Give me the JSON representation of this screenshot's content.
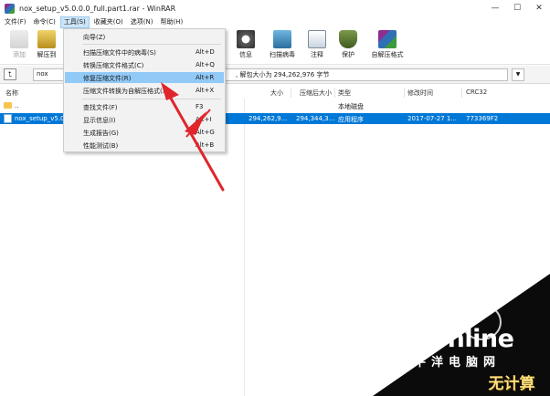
{
  "window": {
    "title": "nox_setup_v5.0.0.0_full.part1.rar - WinRAR",
    "controls": [
      "—",
      "☐",
      "✕"
    ]
  },
  "menubar": {
    "items": [
      "文件(F)",
      "命令(C)",
      "工具(S)",
      "收藏夹(O)",
      "选项(N)",
      "帮助(H)"
    ]
  },
  "toolbar": {
    "items": [
      {
        "label": "添加",
        "icon": "add-archive-icon",
        "disabled": true
      },
      {
        "label": "解压到",
        "icon": "extract-to-icon",
        "disabled": false
      },
      {
        "label": "信息",
        "icon": "info-icon",
        "disabled": false
      },
      {
        "label": "扫描病毒",
        "icon": "virus-scan-icon",
        "disabled": false
      },
      {
        "label": "注释",
        "icon": "comment-icon",
        "disabled": false
      },
      {
        "label": "保护",
        "icon": "protect-icon",
        "disabled": false
      },
      {
        "label": "自解压格式",
        "icon": "sfx-icon",
        "disabled": false
      }
    ]
  },
  "addressbar": {
    "up_glyph": "⮤",
    "path_prefix": "nox",
    "path_text": ", 解包大小为 294,262,976 字节"
  },
  "list": {
    "columns": [
      "名称",
      "大小",
      "压缩后大小",
      "类型",
      "修改时间",
      "CRC32"
    ],
    "rows": [
      {
        "name": "..",
        "size": "",
        "packed": "",
        "type": "本地磁盘",
        "modified": "",
        "crc": "",
        "selected": false
      },
      {
        "name": "nox_setup_v5.0",
        "size": "294,262,9...",
        "packed": "294,344,3...",
        "type": "应用程序",
        "modified": "2017-07-27 1...",
        "crc": "773369F2",
        "selected": true
      }
    ]
  },
  "tools_menu": {
    "items": [
      {
        "label": "向导(Z)",
        "shortcut": "",
        "highlighted": false
      },
      {
        "label": "扫描压缩文件中的病毒(S)",
        "shortcut": "Alt+D",
        "highlighted": false
      },
      {
        "label": "转换压缩文件格式(C)",
        "shortcut": "Alt+Q",
        "highlighted": false
      },
      {
        "label": "修复压缩文件(R)",
        "shortcut": "Alt+R",
        "highlighted": true
      },
      {
        "label": "压缩文件转换为自解压格式(X)",
        "shortcut": "Alt+X",
        "highlighted": false
      },
      {
        "label": "查找文件(F)",
        "shortcut": "F3",
        "highlighted": false
      },
      {
        "label": "显示信息(I)",
        "shortcut": "Alt+I",
        "highlighted": false
      },
      {
        "label": "生成报告(G)",
        "shortcut": "Alt+G",
        "highlighted": false
      },
      {
        "label": "性能测试(B)",
        "shortcut": "Alt+B",
        "highlighted": false
      }
    ]
  },
  "watermark": {
    "logo": "PConline",
    "subtitle": "太平洋电脑网",
    "badge": "无计算"
  },
  "colors": {
    "selection": "#0078d7",
    "menu_highlight": "#91c9f7",
    "annotation_arrow": "#e0252b"
  }
}
